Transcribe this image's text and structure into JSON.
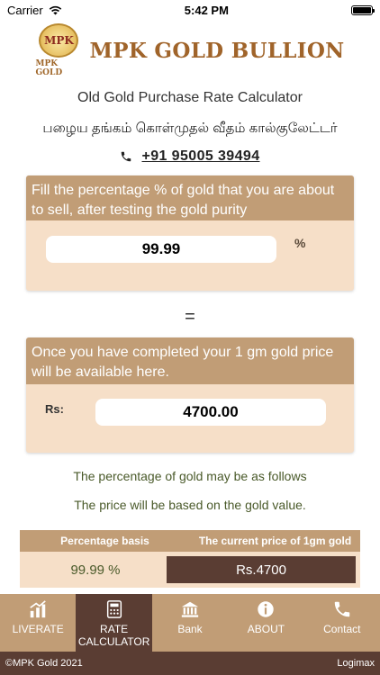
{
  "status": {
    "carrier": "Carrier",
    "time": "5:42 PM"
  },
  "header": {
    "logo_text": "MPK",
    "logo_sub": "MPK GOLD",
    "brand": "MPK GOLD BULLION"
  },
  "page": {
    "title_en": "Old Gold Purchase Rate Calculator",
    "title_ta": "பழைய தங்கம் கொள்முதல் வீதம் கால்குலேட்டர்",
    "phone": "+91 95005 39494"
  },
  "purity_card": {
    "instruction": "Fill the percentage % of gold that you are about to sell, after testing the gold purity",
    "value": "99.99",
    "unit": "%"
  },
  "equals": "=",
  "price_card": {
    "instruction": "Once you have completed your 1 gm gold price will be available here.",
    "label": "Rs:",
    "value": "4700.00"
  },
  "info": {
    "line1": "The percentage of gold may be as follows",
    "line2": "The price will be based on the gold value."
  },
  "rate_table": {
    "headers": [
      "Percentage basis",
      "The current price of 1gm gold"
    ],
    "rows": [
      {
        "percentage": "99.99 %",
        "price": "Rs.4700"
      }
    ]
  },
  "tabs": [
    {
      "label": "LIVERATE",
      "icon": "chart-icon"
    },
    {
      "label": "RATE CALCULATOR",
      "icon": "calculator-icon",
      "active": true
    },
    {
      "label": "Bank",
      "icon": "bank-icon"
    },
    {
      "label": "ABOUT",
      "icon": "info-icon"
    },
    {
      "label": "Contact",
      "icon": "phone-icon"
    }
  ],
  "footer": {
    "left": "©MPK Gold 2021",
    "right": "Logimax"
  },
  "colors": {
    "accent": "#c19d76",
    "dark": "#5a3d33",
    "light": "#f6dfc8",
    "brand": "#a0642a"
  }
}
